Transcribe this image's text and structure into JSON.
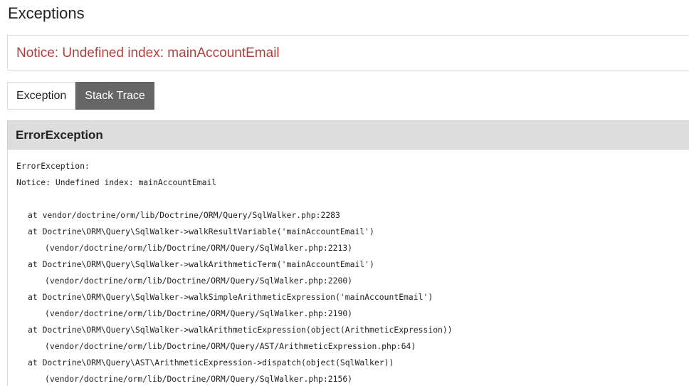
{
  "page": {
    "title": "Exceptions"
  },
  "notice": {
    "message": "Notice: Undefined index: mainAccountEmail",
    "color": "#b0413e"
  },
  "tabs": [
    {
      "label": "Exception",
      "active": false
    },
    {
      "label": "Stack Trace",
      "active": true
    }
  ],
  "panel": {
    "header": "ErrorException",
    "lines": [
      {
        "text": "ErrorException:",
        "indent": 0
      },
      {
        "text": "Notice: Undefined index: mainAccountEmail",
        "indent": 0
      },
      {
        "text": "",
        "indent": 0
      },
      {
        "text": "at vendor/doctrine/orm/lib/Doctrine/ORM/Query/SqlWalker.php:2283",
        "indent": 1
      },
      {
        "text": "at Doctrine\\ORM\\Query\\SqlWalker->walkResultVariable('mainAccountEmail')",
        "indent": 1
      },
      {
        "text": "(vendor/doctrine/orm/lib/Doctrine/ORM/Query/SqlWalker.php:2213)",
        "indent": 2
      },
      {
        "text": "at Doctrine\\ORM\\Query\\SqlWalker->walkArithmeticTerm('mainAccountEmail')",
        "indent": 1
      },
      {
        "text": "(vendor/doctrine/orm/lib/Doctrine/ORM/Query/SqlWalker.php:2200)",
        "indent": 2
      },
      {
        "text": "at Doctrine\\ORM\\Query\\SqlWalker->walkSimpleArithmeticExpression('mainAccountEmail')",
        "indent": 1
      },
      {
        "text": "(vendor/doctrine/orm/lib/Doctrine/ORM/Query/SqlWalker.php:2190)",
        "indent": 2
      },
      {
        "text": "at Doctrine\\ORM\\Query\\SqlWalker->walkArithmeticExpression(object(ArithmeticExpression))",
        "indent": 1
      },
      {
        "text": "(vendor/doctrine/orm/lib/Doctrine/ORM/Query/AST/ArithmeticExpression.php:64)",
        "indent": 2
      },
      {
        "text": "at Doctrine\\ORM\\Query\\AST\\ArithmeticExpression->dispatch(object(SqlWalker))",
        "indent": 1
      },
      {
        "text": "(vendor/doctrine/orm/lib/Doctrine/ORM/Query/SqlWalker.php:2156)",
        "indent": 2
      }
    ]
  }
}
